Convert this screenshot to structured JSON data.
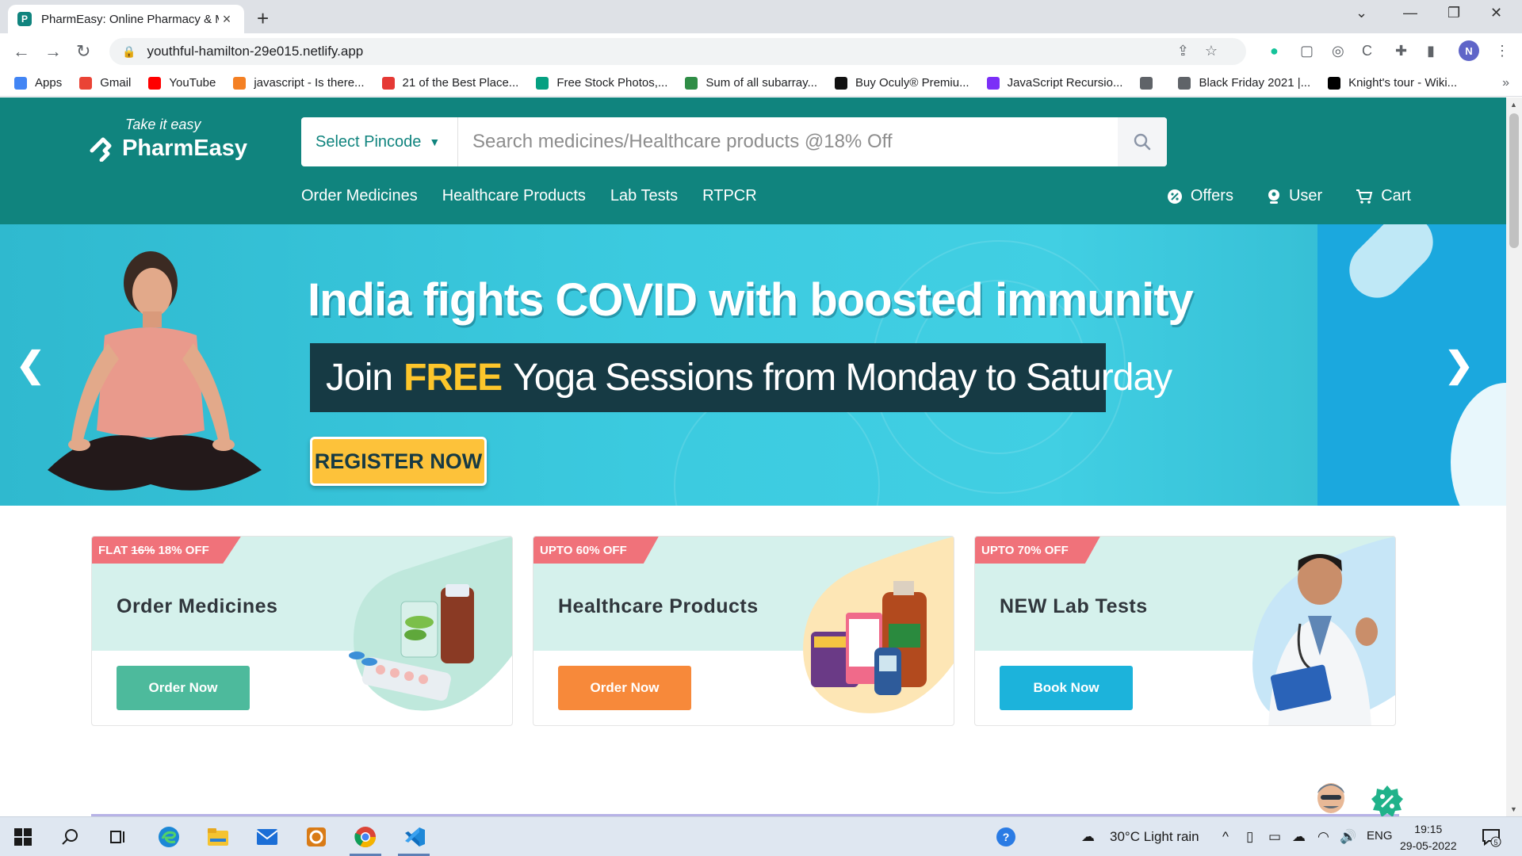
{
  "browser": {
    "tab_title": "PharmEasy: Online Pharmacy & M",
    "url": "youthful-hamilton-29e015.netlify.app",
    "avatar_letter": "N",
    "bookmarks": [
      {
        "label": "Apps",
        "icon": "apps-grid-icon",
        "color": "#4285f4"
      },
      {
        "label": "Gmail",
        "icon": "gmail-icon",
        "color": "#ea4335"
      },
      {
        "label": "YouTube",
        "icon": "youtube-icon",
        "color": "#ff0000"
      },
      {
        "label": "javascript - Is there...",
        "icon": "stackoverflow-icon",
        "color": "#f48024"
      },
      {
        "label": "21 of the Best Place...",
        "icon": "pin-icon",
        "color": "#e53935"
      },
      {
        "label": "Free Stock Photos,...",
        "icon": "pexels-icon",
        "color": "#05a081"
      },
      {
        "label": "Sum of all subarray...",
        "icon": "geeksforgeeks-icon",
        "color": "#2f8d46"
      },
      {
        "label": "Buy Oculy® Premiu...",
        "icon": "amazon-icon",
        "color": "#111111"
      },
      {
        "label": "JavaScript Recursio...",
        "icon": "p-icon",
        "color": "#7b2ff7"
      },
      {
        "label": "",
        "icon": "globe-icon",
        "color": "#5f6368"
      },
      {
        "label": "Black Friday 2021 |...",
        "icon": "globe-icon",
        "color": "#5f6368"
      },
      {
        "label": "Knight's tour - Wiki...",
        "icon": "wikipedia-icon",
        "color": "#000000"
      }
    ]
  },
  "header": {
    "tagline": "Take it easy",
    "brand": "PharmEasy",
    "pincode_label": "Select Pincode",
    "search_placeholder": "Search medicines/Healthcare products @18% Off",
    "nav": [
      "Order Medicines",
      "Healthcare Products",
      "Lab Tests",
      "RTPCR"
    ],
    "right": {
      "offers": "Offers",
      "user": "User",
      "cart": "Cart"
    },
    "colors": {
      "primary": "#10847e"
    }
  },
  "banner": {
    "headline": "India fights COVID with boosted immunity",
    "sub_prefix": "Join",
    "sub_highlight": "FREE",
    "sub_suffix": "Yoga Sessions from Monday to Saturday",
    "cta": "REGISTER NOW",
    "prev": "❮",
    "next": "❯"
  },
  "cards": [
    {
      "ribbon_strike": "16%",
      "ribbon_prefix": "FLAT",
      "ribbon_rest": "18% OFF",
      "ribbon_color": "#f0727a",
      "title": "Order Medicines",
      "cta": "Order Now",
      "cta_color": "#4dba9c",
      "blob_color": "#bfe8dc"
    },
    {
      "ribbon_text": "UPTO 60% OFF",
      "ribbon_color": "#f0727a",
      "title": "Healthcare Products",
      "cta": "Order Now",
      "cta_color": "#f7893a",
      "blob_color": "#fde6b5"
    },
    {
      "ribbon_text": "UPTO 70% OFF",
      "ribbon_color": "#f0727a",
      "title": "NEW Lab Tests",
      "cta": "Book Now",
      "cta_color": "#1cb3db",
      "blob_color": "#c7e6f7"
    }
  ],
  "taskbar": {
    "weather": "30°C  Light rain",
    "lang": "ENG",
    "time": "19:15",
    "date": "29-05-2022",
    "notif_count": "5"
  }
}
